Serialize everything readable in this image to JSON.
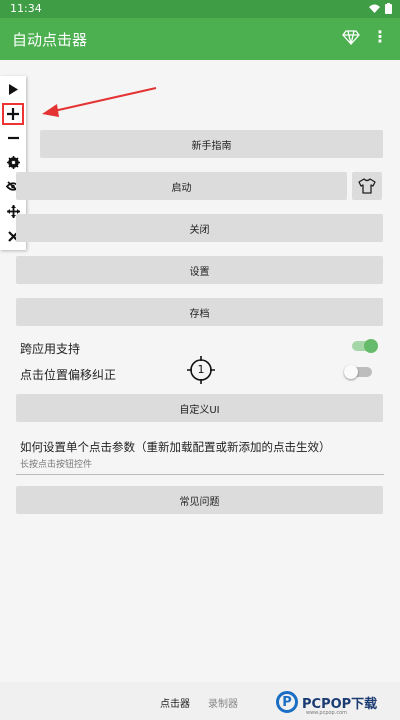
{
  "status_bar": {
    "time": "11:34"
  },
  "app_bar": {
    "title": "自动点击器",
    "gem_icon": "diamond-icon",
    "more_icon": "more-vert-icon"
  },
  "floating_toolbar": {
    "items": [
      "play-icon",
      "plus-icon",
      "minus-icon",
      "gear-icon",
      "eye-off-icon",
      "move-icon",
      "close-icon"
    ],
    "highlight_color": "#e33333"
  },
  "main": {
    "newbie_guide": "新手指南",
    "start": "启动",
    "close": "关闭",
    "settings": "设置",
    "archive": "存档",
    "cross_app_label": "跨应用支持",
    "cross_app_on": true,
    "offset_label": "点击位置偏移纠正",
    "offset_on": false,
    "target_number": "1",
    "custom_ui": "自定义UI",
    "howto_title": "如何设置单个点击参数（重新加载配置或新添加的点击生效）",
    "howto_sub": "长按点击按钮控件",
    "faq": "常见问题"
  },
  "bottom_nav": {
    "clicker": "点击器",
    "recorder": "录制器"
  },
  "watermark": {
    "brand": "PCPOP下载",
    "letter": "P",
    "sub": "www.pcpop.com"
  },
  "colors": {
    "primary": "#4caf50",
    "status": "#3f9d46",
    "accent_toggle": "#66bb6a",
    "arrow": "#e33333"
  }
}
